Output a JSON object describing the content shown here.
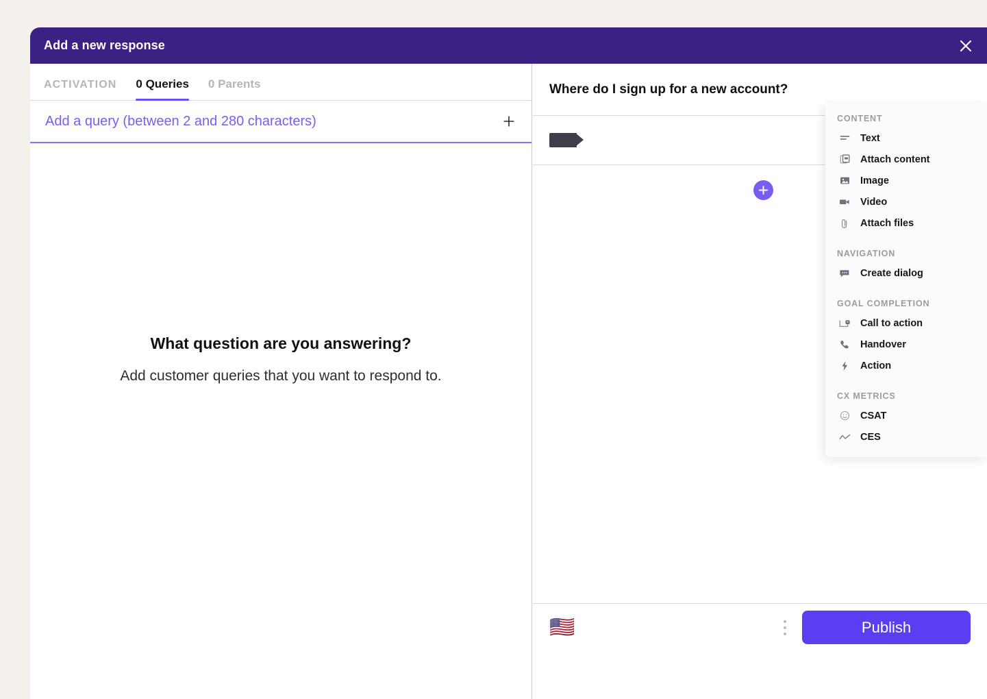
{
  "header": {
    "title": "Add a new response",
    "close_icon": "close-icon",
    "bg_color": "#3a2183"
  },
  "left_panel": {
    "tabs": [
      {
        "label": "ACTIVATION",
        "active": false,
        "muted": true
      },
      {
        "label": "0 Queries",
        "active": true,
        "muted": false
      },
      {
        "label": "0 Parents",
        "active": false,
        "muted": true
      }
    ],
    "query_input": {
      "placeholder": "Add a query (between 2 and 280 characters)",
      "value": "",
      "add_icon": "plus-icon",
      "accent_color": "#6c4ef5"
    },
    "empty_state": {
      "title": "What question are you answering?",
      "subtitle": "Add customer queries that you want to respond to."
    }
  },
  "right_panel": {
    "question": "Where do I sign up for a new account?",
    "content_tag": {
      "name": "content-tag",
      "color": "#3e3e4c"
    },
    "add_block_button": {
      "icon": "plus-icon",
      "color": "#7b5cf0"
    },
    "footer": {
      "language_flag": "🇺🇸",
      "more_menu_icon": "more-vertical-icon",
      "publish_label": "Publish",
      "publish_color": "#5b3df2"
    }
  },
  "block_menu": {
    "groups": [
      {
        "label": "CONTENT",
        "items": [
          {
            "label": "Text",
            "icon": "text-lines-icon"
          },
          {
            "label": "Attach content",
            "icon": "attach-content-icon"
          },
          {
            "label": "Image",
            "icon": "image-icon"
          },
          {
            "label": "Video",
            "icon": "video-camera-icon"
          },
          {
            "label": "Attach files",
            "icon": "paperclip-icon"
          }
        ]
      },
      {
        "label": "NAVIGATION",
        "items": [
          {
            "label": "Create dialog",
            "icon": "speech-bubble-icon"
          }
        ]
      },
      {
        "label": "GOAL COMPLETION",
        "items": [
          {
            "label": "Call to action",
            "icon": "call-to-action-icon"
          },
          {
            "label": "Handover",
            "icon": "phone-icon"
          },
          {
            "label": "Action",
            "icon": "lightning-bolt-icon"
          }
        ]
      },
      {
        "label": "CX METRICS",
        "items": [
          {
            "label": "CSAT",
            "icon": "smiley-icon"
          },
          {
            "label": "CES",
            "icon": "zigzag-line-icon"
          }
        ]
      }
    ]
  }
}
